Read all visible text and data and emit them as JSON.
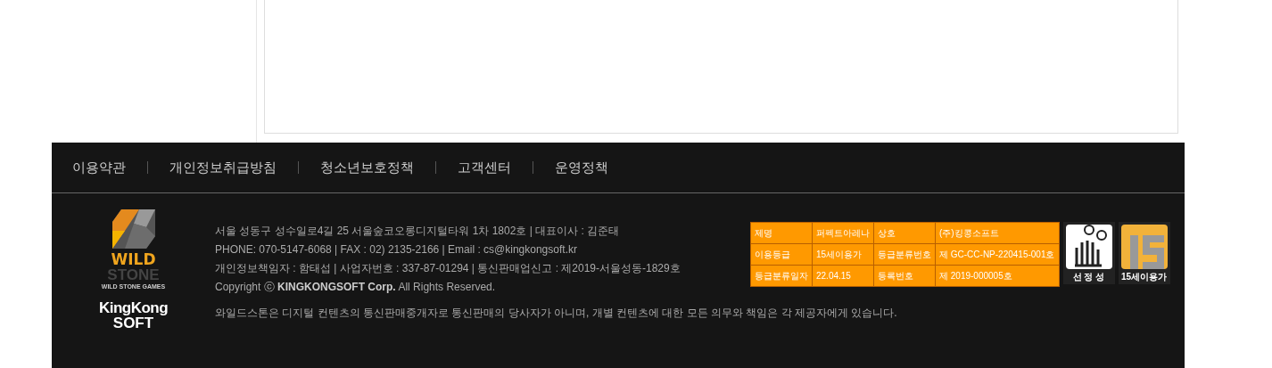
{
  "footer_nav": [
    {
      "label": "이용약관"
    },
    {
      "label": "개인정보취급방침"
    },
    {
      "label": "청소년보호정책"
    },
    {
      "label": "고객센터"
    },
    {
      "label": "운영정책"
    }
  ],
  "logos": {
    "wildstone": {
      "title": "WILD",
      "subtitle": "STONE",
      "caption": "WILD STONE GAMES"
    },
    "kingkong": {
      "line1": "KingKong",
      "line2": "SOFT"
    }
  },
  "company_info": [
    "서울 성동구 성수일로4길 25 서울숲코오롱디지털타워 1차 1802호 | 대표이사 : 김준태",
    "PHONE: 070-5147-6068 | FAX : 02) 2135-2166 | Email : cs@kingkongsoft.kr",
    "개인정보책임자 : 함태섭 | 사업자번호 : 337-87-01294 | 통신판매업신고 : 제2019-서울성동-1829호",
    "Copyright ⓒ **KINGKONGSOFT Corp.** All Rights Reserved."
  ],
  "disclaimer": "와일드스톤은 디지털 컨텐츠의 통신판매중개자로 통신판매의 당사자가 아니며, 개별 컨텐츠에 대한 모든 의무와 책임은 각 제공자에게 있습니다.",
  "rating_table": [
    [
      "제명",
      "퍼펙트아레나",
      "상호",
      "(주)킹콩소프트"
    ],
    [
      "이용등급",
      "15세이용가",
      "등급분류번호",
      "제 GC-CC-NP-220415-001호"
    ],
    [
      "등급분류일자",
      "22.04.15",
      "등록번호",
      "제 2019-000005호"
    ]
  ],
  "rating_badges": [
    {
      "kind": "content",
      "label": "선 정 성"
    },
    {
      "kind": "age",
      "label": "15세이용가"
    }
  ]
}
